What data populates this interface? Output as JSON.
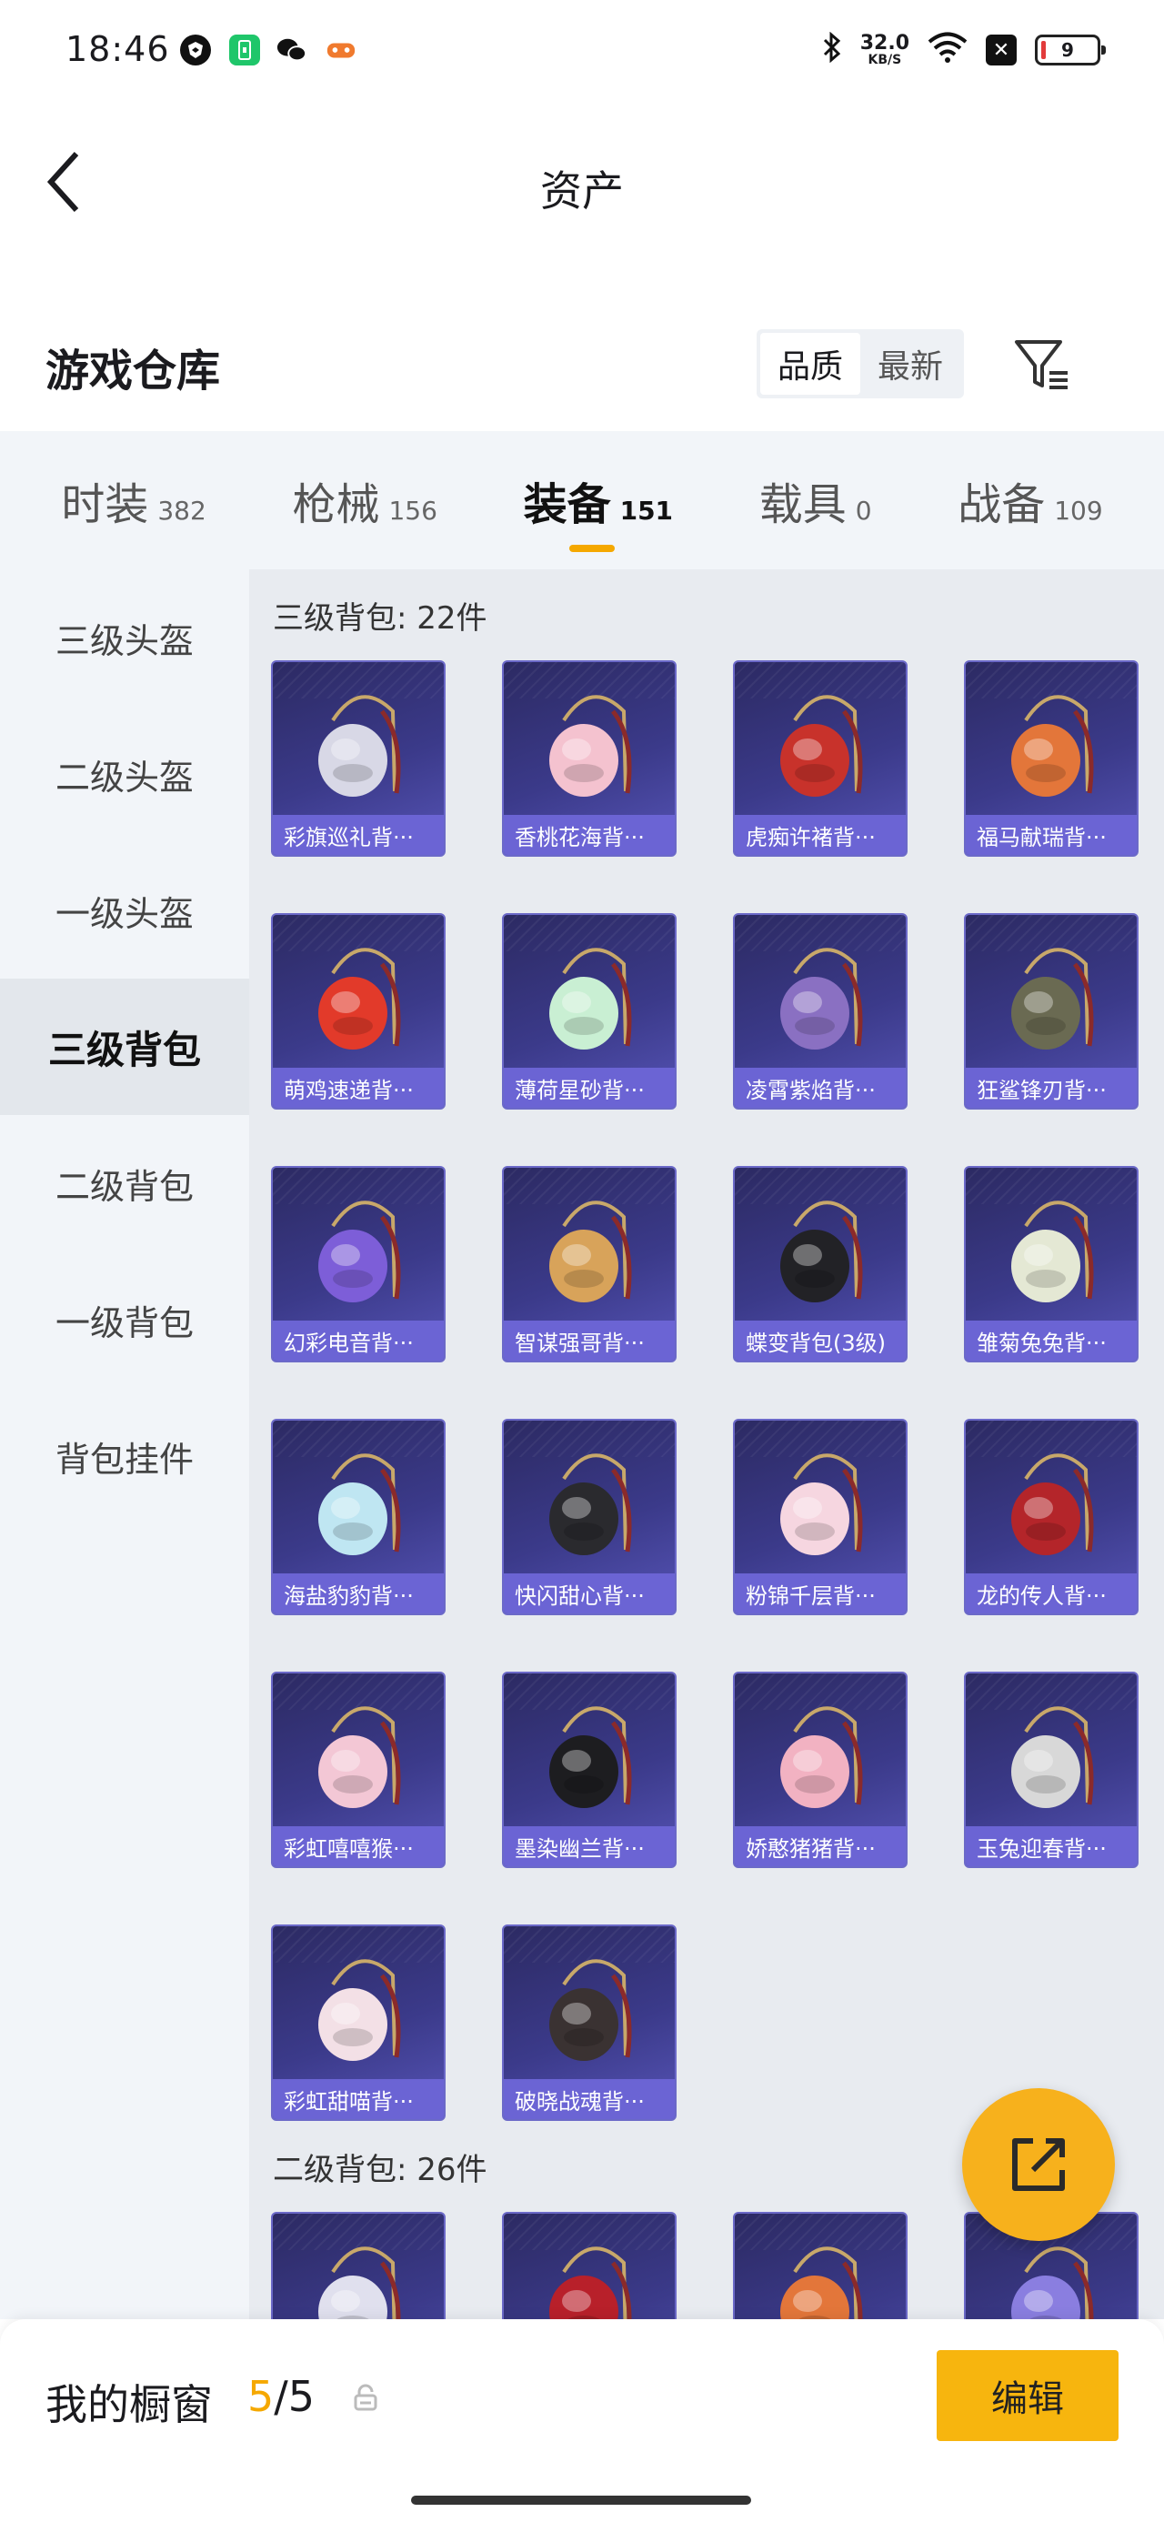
{
  "status_bar": {
    "time": "18:46",
    "net_speed": "32.0",
    "net_unit": "KB/S",
    "battery": "9",
    "icons": [
      "shield-app-icon",
      "phone-app-icon",
      "wechat-icon",
      "game-app-icon",
      "bluetooth-icon",
      "wifi-icon",
      "close-box-icon",
      "battery-icon"
    ]
  },
  "header": {
    "title": "资产",
    "back_icon": "chevron-left-icon"
  },
  "warehouse": {
    "title": "游戏仓库",
    "sort": [
      "品质",
      "最新"
    ],
    "filter_icon": "filter-list-icon"
  },
  "categories": [
    {
      "label": "时装",
      "count": "382"
    },
    {
      "label": "枪械",
      "count": "156"
    },
    {
      "label": "装备",
      "count": "151"
    },
    {
      "label": "载具",
      "count": "0"
    },
    {
      "label": "战备",
      "count": "109"
    }
  ],
  "side_nav": [
    "三级头盔",
    "二级头盔",
    "一级头盔",
    "三级背包",
    "二级背包",
    "一级背包",
    "背包挂件"
  ],
  "sections": [
    {
      "title": "三级背包: 22件",
      "items": [
        "彩旗巡礼背···",
        "香桃花海背···",
        "虎痴许褚背···",
        "福马献瑞背···",
        "萌鸡速递背···",
        "薄荷星砂背···",
        "凌霄紫焰背···",
        "狂鲨锋刃背···",
        "幻彩电音背···",
        "智谋强哥背···",
        "蝶变背包(3级)",
        "雏菊兔兔背···",
        "海盐豹豹背···",
        "快闪甜心背···",
        "粉锦千层背···",
        "龙的传人背···",
        "彩虹嘻嘻猴···",
        "墨染幽兰背···",
        "娇憨猪猪背···",
        "玉兔迎春背···",
        "彩虹甜喵背···",
        "破晓战魂背···"
      ]
    },
    {
      "title": "二级背包: 26件",
      "items": [
        "",
        "",
        "",
        ""
      ]
    }
  ],
  "colors": {
    "accent": "#f5a800",
    "card_bg": "#3b3a8a",
    "card_label": "#6b64d4",
    "bag_colors": [
      "#d8d8e6",
      "#f4c2cf",
      "#c8322b",
      "#e3763a",
      "#e23a2a",
      "#c9efd3",
      "#8a70c2",
      "#6a6a52",
      "#7d5ed8",
      "#d8a35a",
      "#222226",
      "#e4e8d4",
      "#bfe6f2",
      "#2a2a2e",
      "#f6d6e0",
      "#b4252a",
      "#f3c7d5",
      "#1d1d20",
      "#f2b2c2",
      "#d8d8d8",
      "#f3e0e6",
      "#3a3232"
    ]
  },
  "showcase": {
    "label": "我的橱窗",
    "current": "5",
    "total": "/5",
    "edit_label": "编辑"
  },
  "fab_icon": "share-out-icon"
}
